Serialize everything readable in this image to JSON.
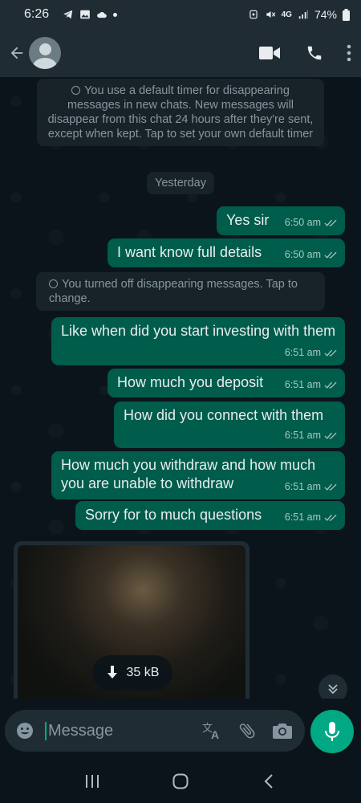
{
  "status_bar": {
    "time": "6:26",
    "left_icons": [
      "telegram-icon",
      "image-icon",
      "cloud-icon",
      "dot-icon"
    ],
    "right_icons": [
      "alarm-icon",
      "mute-icon",
      "network-4g-icon",
      "signal-icon"
    ],
    "network_label": "4G",
    "battery": "74%"
  },
  "header": {
    "actions": [
      "video-call-icon",
      "voice-call-icon",
      "more-menu-icon"
    ]
  },
  "chat": {
    "system_notice_1": "You use a default timer for disappearing messages in new chats. New messages will disappear from this chat 24 hours after they're sent, except when kept. Tap to set your own default timer",
    "date_separator": "Yesterday",
    "system_notice_2": "You turned off disappearing messages. Tap to change.",
    "messages": [
      {
        "text": "Yes sir",
        "time": "6:50 am"
      },
      {
        "text": "I want know full details",
        "time": "6:50 am"
      },
      {
        "text": "Like when did you start investing with them",
        "time": "6:51 am"
      },
      {
        "text": "How much you deposit",
        "time": "6:51 am"
      },
      {
        "text": "How did you connect with them",
        "time": "6:51 am"
      },
      {
        "text": "How much you withdraw and how much you are unable to withdraw",
        "time": "6:51 am"
      },
      {
        "text": "Sorry for to much questions",
        "time": "6:51 am"
      }
    ],
    "media": {
      "download_size": "35 kB"
    }
  },
  "composer": {
    "placeholder": "Message",
    "value": "",
    "actions": [
      "translate-icon",
      "attach-icon",
      "camera-icon"
    ]
  },
  "nav_bar": [
    "recents-icon",
    "home-icon",
    "back-icon"
  ],
  "colors": {
    "background": "#0b141a",
    "header": "#1f2c34",
    "outgoing_bubble": "#005c4b",
    "accent": "#00a884",
    "system_bubble": "#182229"
  }
}
